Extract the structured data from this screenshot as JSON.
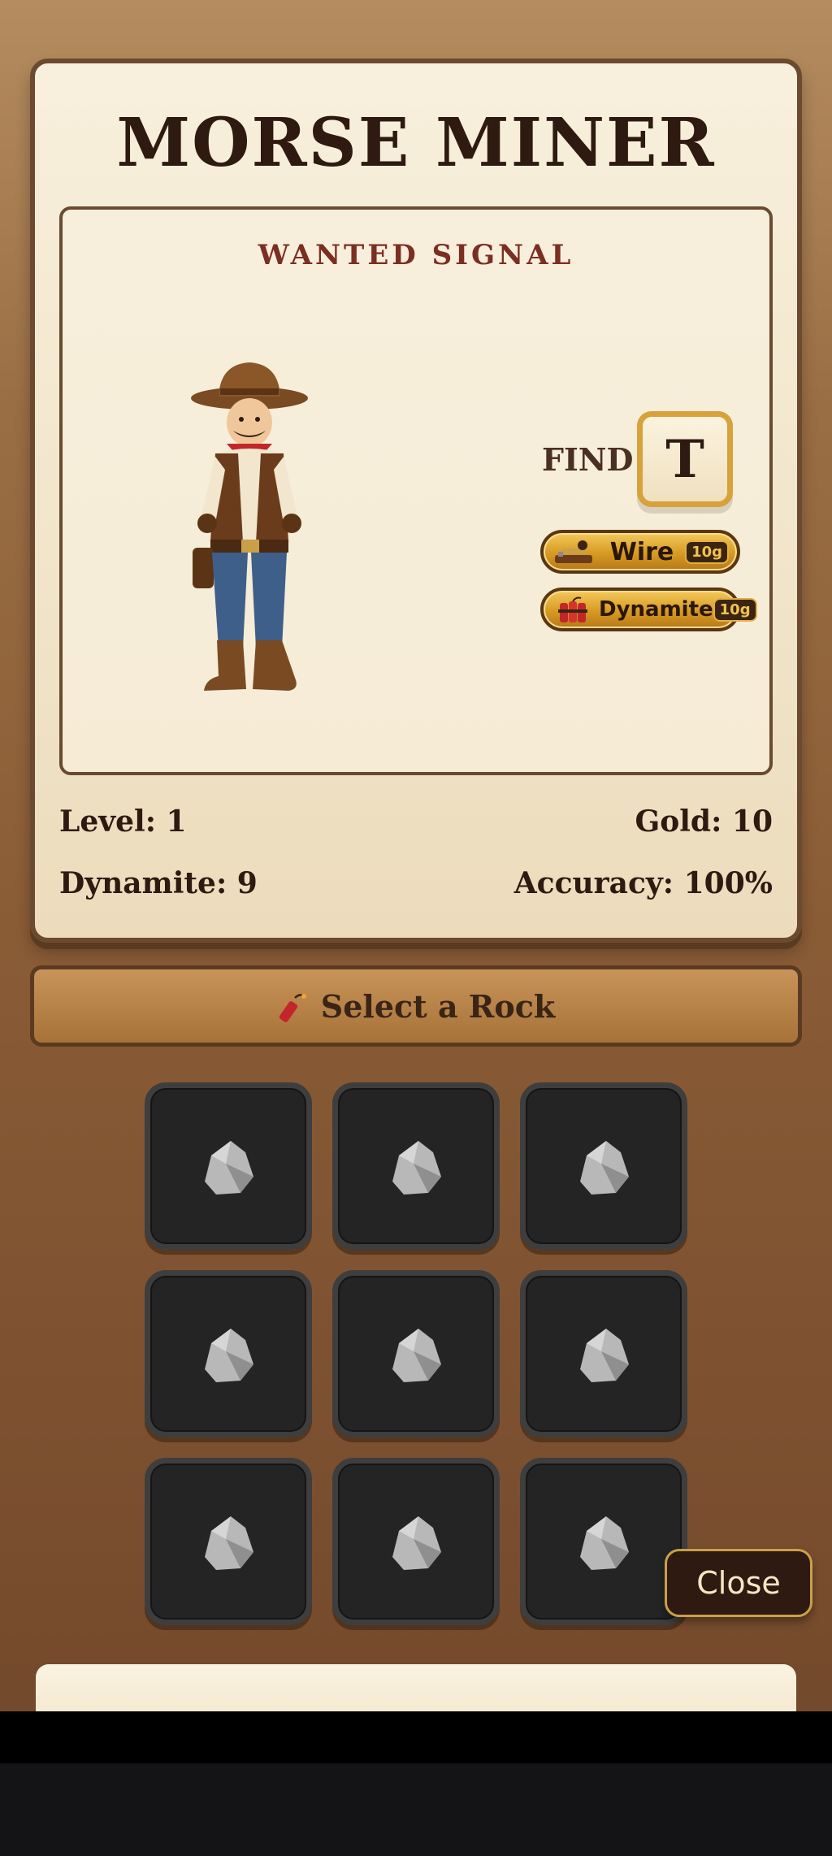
{
  "app": {
    "title": "MORSE MINER"
  },
  "wanted": {
    "heading": "WANTED SIGNAL",
    "find_label": "FIND",
    "target_letter": "T",
    "character_icon": "cowboy-portrait"
  },
  "powerups": [
    {
      "name": "Wire",
      "price": "10g",
      "icon": "telegraph-key-icon"
    },
    {
      "name": "Dynamite",
      "price": "10g",
      "icon": "dynamite-bundle-icon"
    }
  ],
  "stats": {
    "level": "Level: 1",
    "gold": "Gold: 10",
    "dynamite": "Dynamite: 9",
    "accuracy": "Accuracy: 100%"
  },
  "select_bar": {
    "label": "Select a Rock",
    "icon": "dynamite-stick-icon"
  },
  "rocks": {
    "rows": 3,
    "cols": 3,
    "icon": "rock-icon"
  },
  "close_button": {
    "label": "Close"
  },
  "colors": {
    "background": "#8a5c36",
    "card": "#f8f0dd",
    "border": "#6b4a30",
    "accent_red": "#7b2e22",
    "gold": "#d8a23a",
    "rock_cell": "#242424"
  }
}
